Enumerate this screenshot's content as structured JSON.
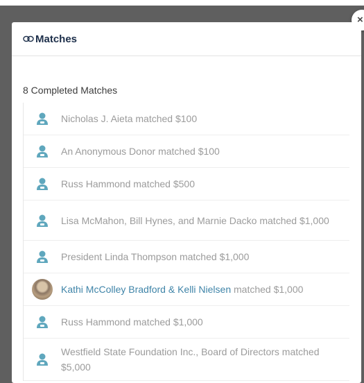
{
  "modal": {
    "title": "Matches",
    "close_icon": "close-icon",
    "header_icon": "infinity-link-icon"
  },
  "section": {
    "title": "8 Completed Matches"
  },
  "colors": {
    "title": "#1d2f4a",
    "avatar_teal": "#5fa7bd",
    "link": "#3f84a8",
    "muted_text": "#9b9b9b"
  },
  "matches": [
    {
      "donor": "Nicholas J. Aieta",
      "verb": "matched",
      "amount": "$100",
      "avatar": "person-icon"
    },
    {
      "donor": "An Anonymous Donor",
      "verb": "matched",
      "amount": "$100",
      "avatar": "person-icon"
    },
    {
      "donor": "Russ Hammond",
      "verb": "matched",
      "amount": "$500",
      "avatar": "person-icon"
    },
    {
      "donor": "Lisa McMahon, Bill Hynes, and Marnie Dacko",
      "verb": "matched",
      "amount": "$1,000",
      "avatar": "person-icon"
    },
    {
      "donor": "President Linda Thompson",
      "verb": "matched",
      "amount": "$1,000",
      "avatar": "person-icon"
    },
    {
      "donor": "Kathi McColley Bradford & Kelli Nielsen",
      "verb": "matched",
      "amount": "$1,000",
      "avatar": "photo"
    },
    {
      "donor": "Russ Hammond",
      "verb": "matched",
      "amount": "$1,000",
      "avatar": "person-icon"
    },
    {
      "donor": "Westfield State Foundation Inc., Board of Directors",
      "verb": "matched",
      "amount": "$5,000",
      "avatar": "person-icon"
    }
  ]
}
